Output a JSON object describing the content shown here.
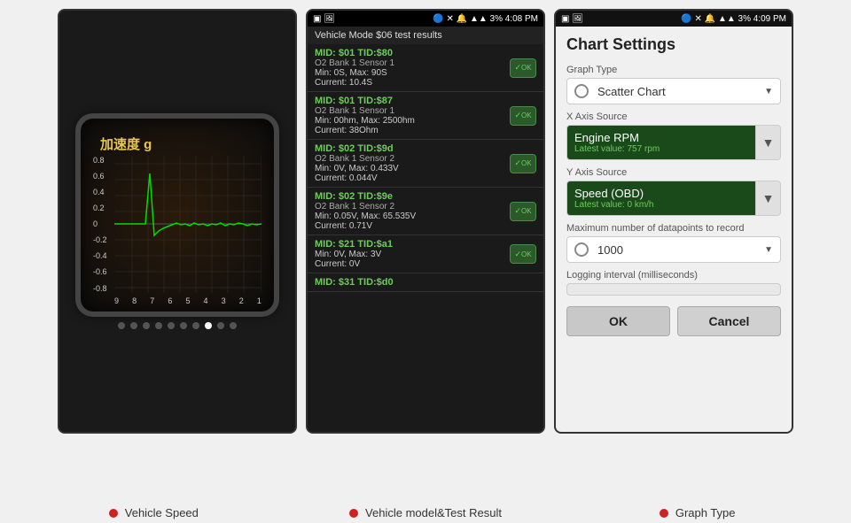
{
  "screen1": {
    "title": "加速度 g",
    "y_labels": [
      "0.8",
      "0.6",
      "0.4",
      "0.2",
      "0",
      "-0.2",
      "-0.4",
      "-0.6",
      "-0.8"
    ],
    "x_labels": [
      "9",
      "8",
      "7",
      "6",
      "5",
      "4",
      "3",
      "2",
      "1"
    ],
    "dots": [
      false,
      false,
      false,
      false,
      false,
      false,
      false,
      true,
      false,
      false
    ]
  },
  "screen2": {
    "statusbar_left": "●",
    "statusbar_right": "▲▲ ● 3% 4:08 PM",
    "header": "Vehicle Mode $06 test results",
    "items": [
      {
        "title": "MID: $01 TID:$80",
        "sub": "O2 Bank 1 Sensor 1",
        "detail": "Min: 0S, Max: 90S\nCurrent: 10.4S",
        "ok": true
      },
      {
        "title": "MID: $01 TID:$87",
        "sub": "O2 Bank 1 Sensor 1",
        "detail": "Min: 00hm, Max: 2500hm\nCurrent: 38Ohm",
        "ok": true
      },
      {
        "title": "MID: $02 TID:$9d",
        "sub": "O2 Bank 1 Sensor 2",
        "detail": "Min: 0V, Max: 0.433V\nCurrent: 0.044V",
        "ok": true
      },
      {
        "title": "MID: $02 TID:$9e",
        "sub": "O2 Bank 1 Sensor 2",
        "detail": "Min: 0.05V, Max: 65.535V\nCurrent: 0.71V",
        "ok": true
      },
      {
        "title": "MID: $21 TID:$a1",
        "sub": "",
        "detail": "Min: 0V, Max: 3V\nCurrent: 0V",
        "ok": true
      },
      {
        "title": "MID: $31 TID:$d0",
        "sub": "",
        "detail": "",
        "ok": false
      }
    ]
  },
  "screen3": {
    "statusbar_left": "●",
    "statusbar_right": "▲▲ ● 3% 4:09 PM",
    "title": "Chart Settings",
    "graph_type_label": "Graph Type",
    "graph_type_value": "Scatter Chart",
    "x_axis_label": "X Axis Source",
    "x_axis_value": "Engine RPM",
    "x_axis_latest": "Latest value: 757 rpm",
    "y_axis_label": "Y Axis Source",
    "y_axis_value": "Speed (OBD)",
    "y_axis_latest": "Latest value: 0 km/h",
    "max_points_label": "Maximum number of datapoints to record",
    "max_points_value": "1000",
    "logging_label": "Logging interval (milliseconds)",
    "ok_label": "OK",
    "cancel_label": "Cancel"
  },
  "captions": [
    {
      "text": "Vehicle Speed"
    },
    {
      "text": "Vehicle model&Test Result"
    },
    {
      "text": "Graph Type"
    }
  ]
}
